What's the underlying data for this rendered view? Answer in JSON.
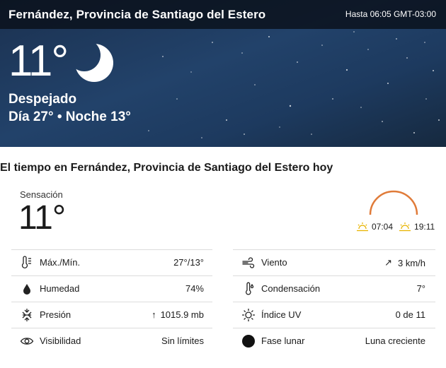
{
  "header": {
    "location": "Fernández, Provincia de Santiago del Estero",
    "valid_until": "Hasta 06:05 GMT-03:00"
  },
  "current": {
    "temperature": "11°",
    "condition": "Despejado",
    "day_night": "Día 27° • Noche 13°",
    "condition_icon": "moon-icon"
  },
  "today": {
    "title": "El tiempo en Fernández, Provincia de Santiago del Estero hoy",
    "feels_like_label": "Sensación",
    "feels_like_value": "11°",
    "sunrise": "07:04",
    "sunset": "19:11"
  },
  "details_left": [
    {
      "icon": "thermometer-icon",
      "label": "Máx./Mín.",
      "value": "27°/13°"
    },
    {
      "icon": "humidity-drop-icon",
      "label": "Humedad",
      "value": "74%"
    },
    {
      "icon": "pressure-icon",
      "label": "Presión",
      "value": "1015.9 mb",
      "arrow": "↑"
    },
    {
      "icon": "visibility-eye-icon",
      "label": "Visibilidad",
      "value": "Sin límites"
    }
  ],
  "details_right": [
    {
      "icon": "wind-icon",
      "label": "Viento",
      "value": "3 km/h",
      "arrow": "↗"
    },
    {
      "icon": "dew-point-icon",
      "label": "Condensación",
      "value": "7°"
    },
    {
      "icon": "uv-index-icon",
      "label": "Índice UV",
      "value": "0 de 11"
    },
    {
      "icon": "moon-phase-icon",
      "label": "Fase lunar",
      "value": "Luna creciente"
    }
  ],
  "colors": {
    "hero_bg": "#1f3b5f",
    "sun_arc": "#e07b39",
    "sun_icon": "#e8b400"
  }
}
